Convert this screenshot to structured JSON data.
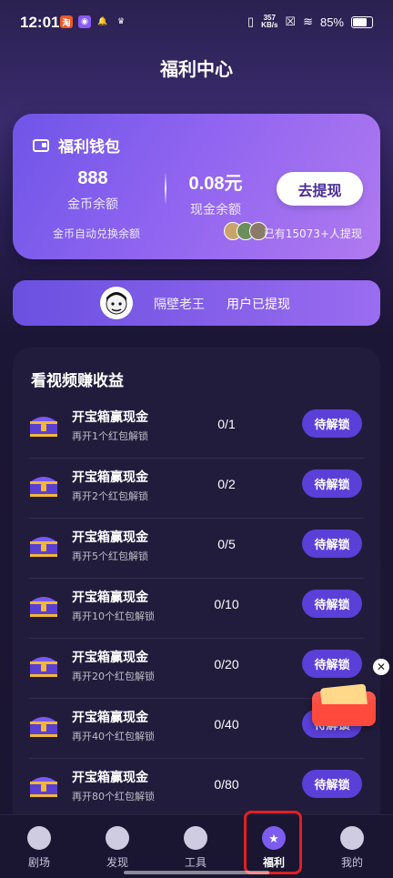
{
  "status_bar": {
    "time": "12:01",
    "net_speed": "357",
    "net_unit": "KB/s",
    "battery": "85%"
  },
  "page": {
    "title": "福利中心"
  },
  "wallet": {
    "title": "福利钱包",
    "coins_value": "888",
    "coins_label": "金币余额",
    "cash_value": "0.08元",
    "cash_label": "现金余额",
    "withdraw_button": "去提现",
    "auto_exchange": "金币自动兑换余额",
    "withdraw_count": "已有15073+人提现"
  },
  "ticker": {
    "user": "隔壁老王",
    "message": "用户已提现"
  },
  "tasks": {
    "title": "看视频赚收益",
    "items": [
      {
        "name": "开宝箱赢现金",
        "sub": "再开1个红包解锁",
        "progress": "0/1",
        "button": "待解锁"
      },
      {
        "name": "开宝箱赢现金",
        "sub": "再开2个红包解锁",
        "progress": "0/2",
        "button": "待解锁"
      },
      {
        "name": "开宝箱赢现金",
        "sub": "再开5个红包解锁",
        "progress": "0/5",
        "button": "待解锁"
      },
      {
        "name": "开宝箱赢现金",
        "sub": "再开10个红包解锁",
        "progress": "0/10",
        "button": "待解锁"
      },
      {
        "name": "开宝箱赢现金",
        "sub": "再开20个红包解锁",
        "progress": "0/20",
        "button": "待解锁"
      },
      {
        "name": "开宝箱赢现金",
        "sub": "再开40个红包解锁",
        "progress": "0/40",
        "button": "待解锁"
      },
      {
        "name": "开宝箱赢现金",
        "sub": "再开80个红包解锁",
        "progress": "0/80",
        "button": "待解锁"
      }
    ]
  },
  "tabbar": {
    "items": [
      {
        "label": "剧场",
        "icon": "theater-icon"
      },
      {
        "label": "发现",
        "icon": "planet-icon"
      },
      {
        "label": "工具",
        "icon": "camera-aperture-icon"
      },
      {
        "label": "福利",
        "icon": "gift-bag-icon"
      },
      {
        "label": "我的",
        "icon": "profile-icon"
      }
    ]
  },
  "colors": {
    "accent": "#7d5cf0",
    "button": "#5a40d8",
    "highlight": "#e02020"
  }
}
